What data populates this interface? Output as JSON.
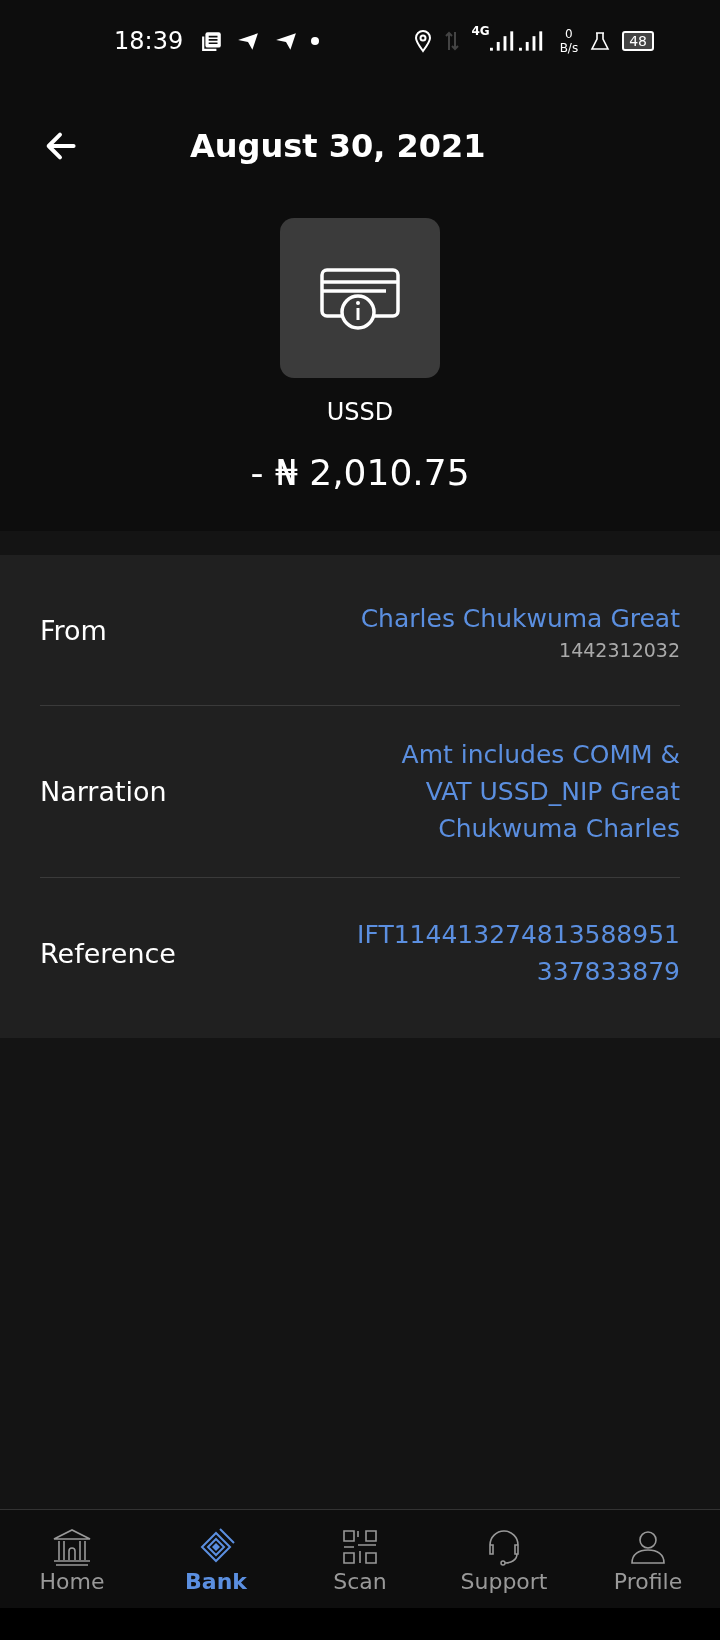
{
  "status_bar": {
    "time": "18:39",
    "network": "4G",
    "speed_value": "0",
    "speed_unit": "B/s",
    "battery": "48"
  },
  "header": {
    "title": "August 30, 2021"
  },
  "transaction": {
    "channel": "USSD",
    "amount": "- ₦ 2,010.75"
  },
  "details": [
    {
      "label": "From",
      "lines": [
        "Charles Chukwuma Great"
      ],
      "sub": "1442312032"
    },
    {
      "label": "Narration",
      "lines": [
        "Amt includes COMM &",
        "VAT USSD_NIP Great",
        "Chukwuma Charles"
      ]
    },
    {
      "label": "Reference",
      "lines": [
        "IFT114413274813588951",
        "337833879"
      ]
    }
  ],
  "nav": [
    {
      "kind": "home",
      "label": "Home",
      "selected": false
    },
    {
      "kind": "bank",
      "label": "Bank",
      "selected": true
    },
    {
      "kind": "scan",
      "label": "Scan",
      "selected": false
    },
    {
      "kind": "support",
      "label": "Support",
      "selected": false
    },
    {
      "kind": "profile",
      "label": "Profile",
      "selected": false
    }
  ]
}
